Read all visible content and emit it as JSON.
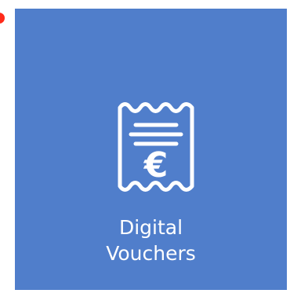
{
  "tile": {
    "label_line1": "Digital",
    "label_line2": "Vouchers",
    "icon": "receipt-euro-icon"
  },
  "colors": {
    "tile_background": "#507ecb",
    "foreground": "#ffffff",
    "edge_indicator": "#ff2a1a"
  }
}
